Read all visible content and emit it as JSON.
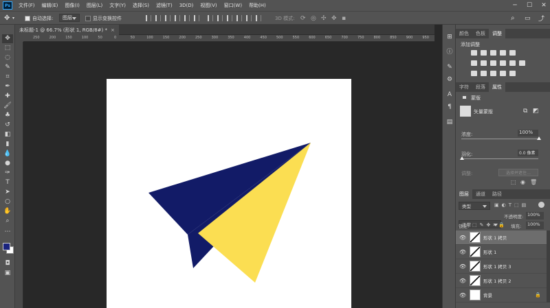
{
  "menubar": {
    "logo": "Ps",
    "items": [
      "文件(F)",
      "编辑(E)",
      "图像(I)",
      "图层(L)",
      "文字(Y)",
      "选择(S)",
      "滤镜(T)",
      "3D(D)",
      "视图(V)",
      "窗口(W)",
      "帮助(H)"
    ],
    "window_controls": [
      "─",
      "☐",
      "✕"
    ]
  },
  "options": {
    "auto_select_label": "自动选择:",
    "auto_select_value": "图层",
    "show_transform_label": "显示变换控件",
    "mode_3d_label": "3D 模式:"
  },
  "document": {
    "tab_title": "未标题-1 @ 66.7% (形状 1, RGB/8#) *",
    "ruler_ticks": [
      "250",
      "200",
      "150",
      "100",
      "50",
      "0",
      "50",
      "100",
      "150",
      "200",
      "250",
      "300",
      "350",
      "400",
      "450",
      "500",
      "550",
      "600",
      "650",
      "700",
      "750",
      "800",
      "850",
      "900",
      "950"
    ]
  },
  "panels": {
    "top_tabs": [
      "颜色",
      "色板",
      "调整"
    ],
    "add_adjustment": "添加调整",
    "mid_tabs": [
      "字符",
      "段落",
      "属性"
    ],
    "mask_label": "蒙版",
    "vector_mask_label": "矢量蒙版",
    "density_label": "浓度:",
    "density_value": "100%",
    "feather_label": "羽化:",
    "feather_value": "0.0 像素",
    "refine_label": "调整:",
    "select_invert_label": "选择并遮住…",
    "layer_tabs": [
      "图层",
      "通道",
      "路径"
    ],
    "filter_type": "类型",
    "blend_mode": "正常",
    "opacity_label": "不透明度:",
    "opacity_value": "100%",
    "lock_label": "锁定:",
    "fill_label": "填充:",
    "fill_value": "100%",
    "layers": [
      {
        "name": "形状 1 拷贝",
        "selected": true
      },
      {
        "name": "形状 1",
        "selected": false
      },
      {
        "name": "形状 1 拷贝 3",
        "selected": false
      },
      {
        "name": "形状 1 拷贝 2",
        "selected": false
      },
      {
        "name": "背景",
        "selected": false
      }
    ]
  },
  "colors": {
    "navy": "#121b67",
    "yellow": "#fbde52",
    "foreground": "#1a237e",
    "background": "#ffffff"
  }
}
